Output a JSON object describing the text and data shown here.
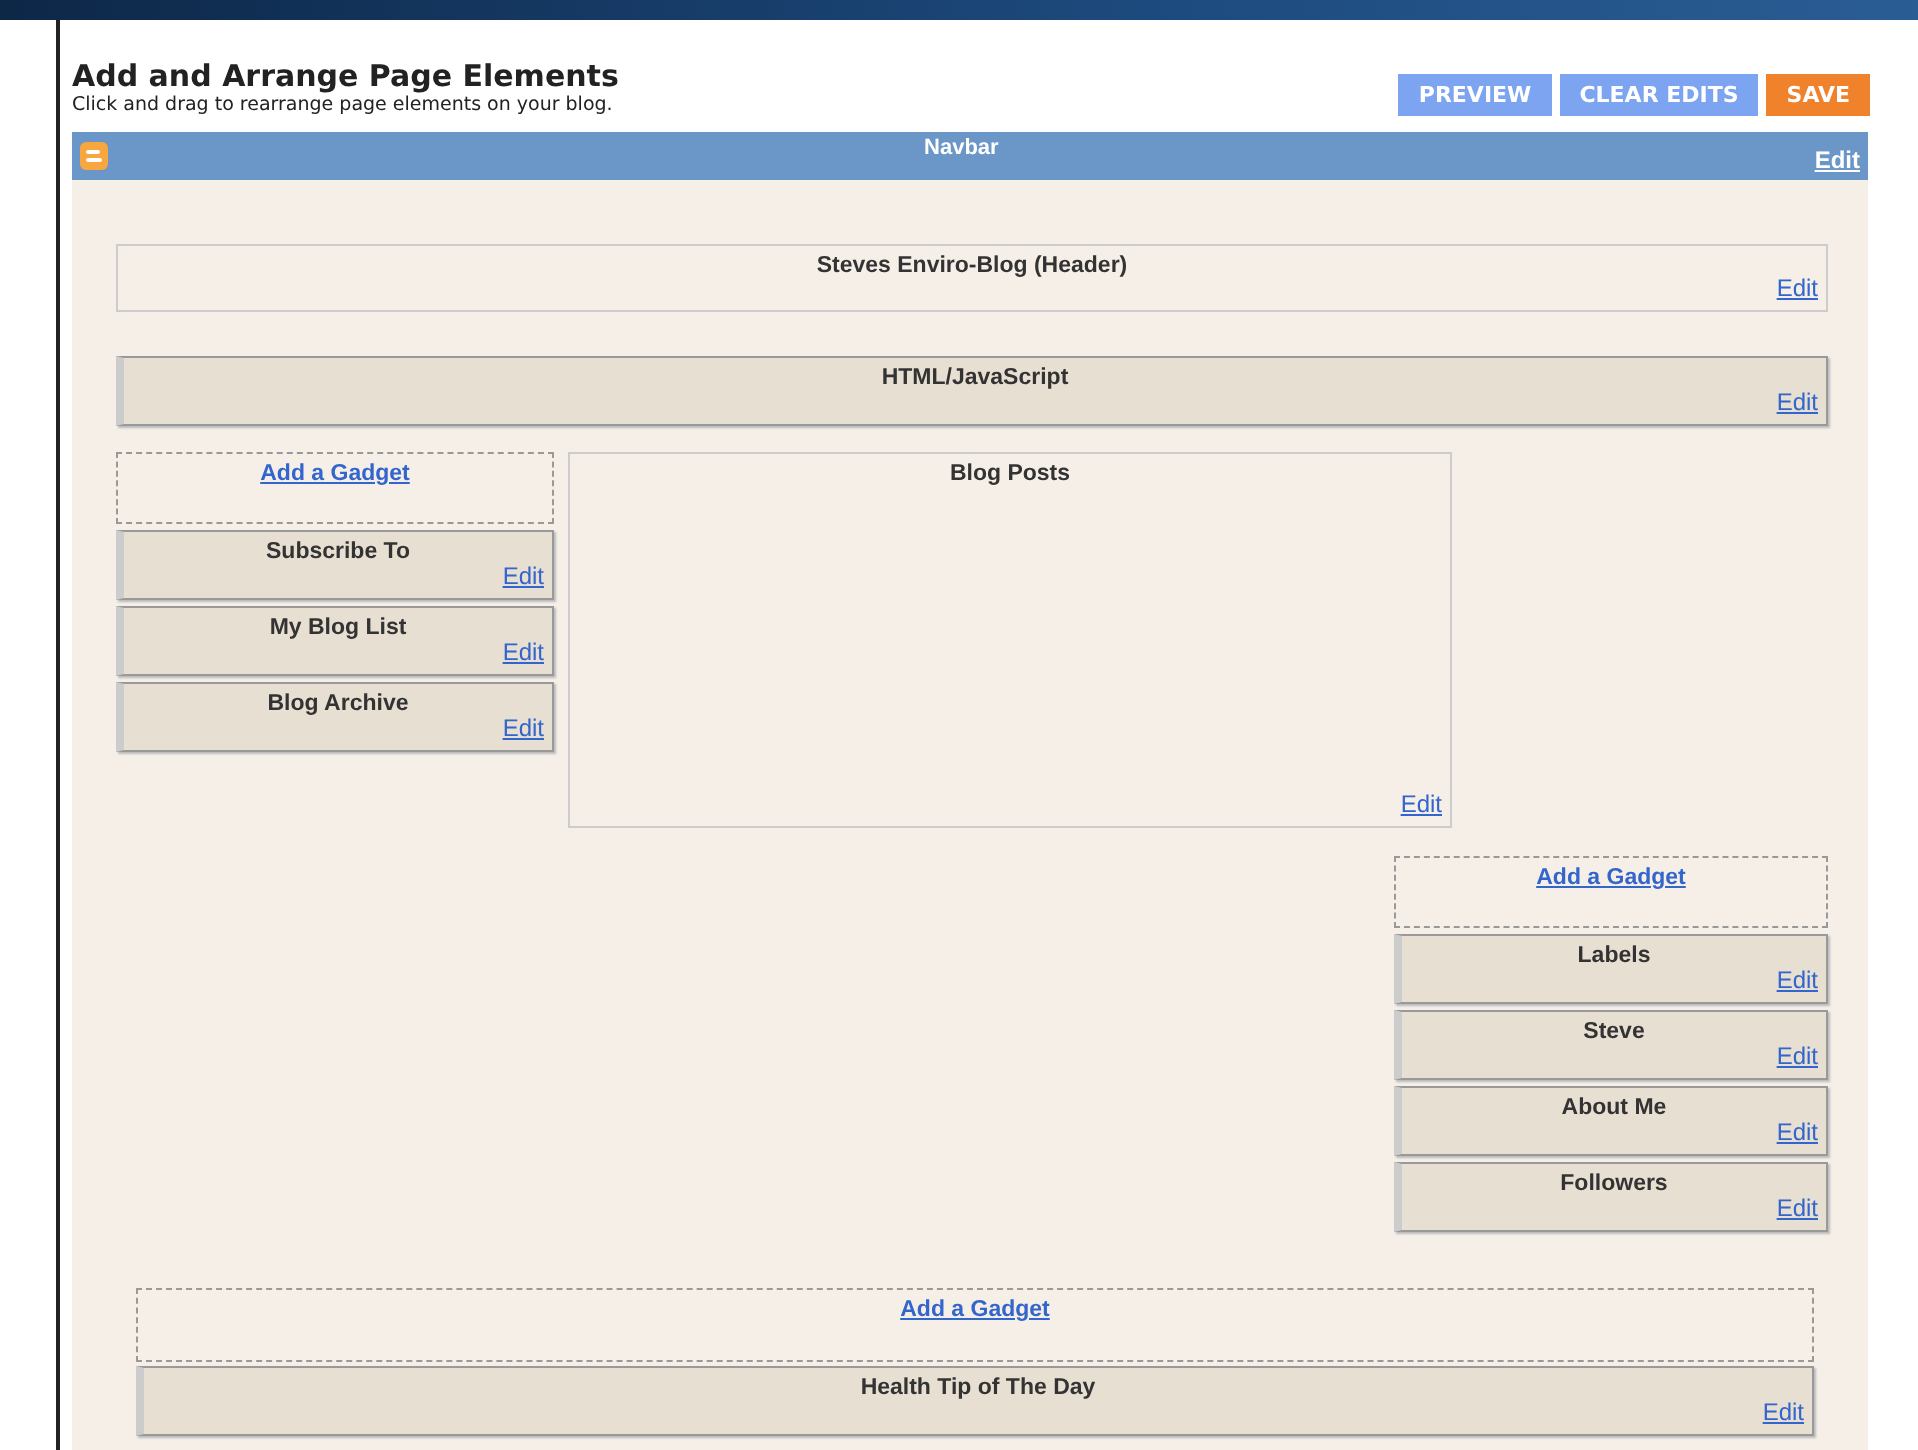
{
  "page": {
    "title": "Add and Arrange Page Elements",
    "subtitle": "Click and drag to rearrange page elements on your blog.",
    "buttons": [
      {
        "label": "PREVIEW",
        "kind": "secondary"
      },
      {
        "label": "CLEAR EDITS",
        "kind": "secondary"
      },
      {
        "label": "SAVE",
        "kind": "primary"
      }
    ]
  },
  "navbar": {
    "title": "Navbar",
    "edit": "Edit"
  },
  "header": {
    "title": "Steves Enviro-Blog (Header)",
    "edit": "Edit"
  },
  "top_gadgets": [
    {
      "title": "HTML/JavaScript",
      "edit": "Edit"
    }
  ],
  "sidebar_left": {
    "add": "Add a Gadget",
    "gadgets": [
      {
        "title": "Subscribe To",
        "edit": "Edit"
      },
      {
        "title": "My Blog List",
        "edit": "Edit"
      },
      {
        "title": "Blog Archive",
        "edit": "Edit"
      }
    ]
  },
  "main": {
    "title": "Blog Posts",
    "edit": "Edit"
  },
  "sidebar_right": {
    "add": "Add a Gadget",
    "gadgets": [
      {
        "title": "Labels",
        "edit": "Edit"
      },
      {
        "title": "Steve",
        "edit": "Edit"
      },
      {
        "title": "About Me",
        "edit": "Edit"
      },
      {
        "title": "Followers",
        "edit": "Edit"
      }
    ]
  },
  "footer": {
    "add": "Add a Gadget",
    "gadgets": [
      {
        "title": "Health Tip of The Day",
        "edit": "Edit"
      }
    ]
  }
}
